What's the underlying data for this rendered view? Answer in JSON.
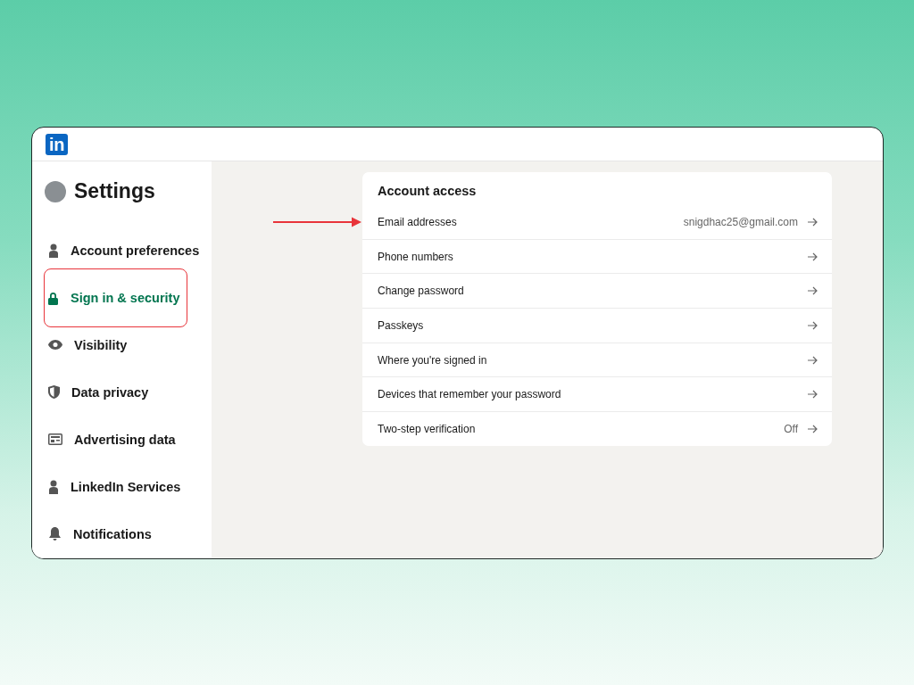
{
  "logo": "in",
  "sidebar": {
    "title": "Settings",
    "items": [
      {
        "label": "Account preferences",
        "kind": "person",
        "selected": false,
        "highlighted": false
      },
      {
        "label": "Sign in & security",
        "kind": "lock",
        "selected": true,
        "highlighted": true
      },
      {
        "label": "Visibility",
        "kind": "eye",
        "selected": false,
        "highlighted": false
      },
      {
        "label": "Data privacy",
        "kind": "shield",
        "selected": false,
        "highlighted": false
      },
      {
        "label": "Advertising data",
        "kind": "ad",
        "selected": false,
        "highlighted": false
      },
      {
        "label": "LinkedIn Services",
        "kind": "person",
        "selected": false,
        "highlighted": false
      },
      {
        "label": "Notifications",
        "kind": "bell",
        "selected": false,
        "highlighted": false
      }
    ]
  },
  "section": {
    "title": "Account access",
    "rows": [
      {
        "label": "Email addresses",
        "value": "snigdhac25@gmail.com",
        "pointed": true
      },
      {
        "label": "Phone numbers",
        "pointed": false
      },
      {
        "label": "Change password",
        "pointed": false
      },
      {
        "label": "Passkeys",
        "pointed": false
      },
      {
        "label": "Where you're signed in",
        "pointed": false
      },
      {
        "label": "Devices that remember your password",
        "pointed": false
      },
      {
        "label": "Two-step verification",
        "value": "Off",
        "pointed": false
      }
    ]
  }
}
